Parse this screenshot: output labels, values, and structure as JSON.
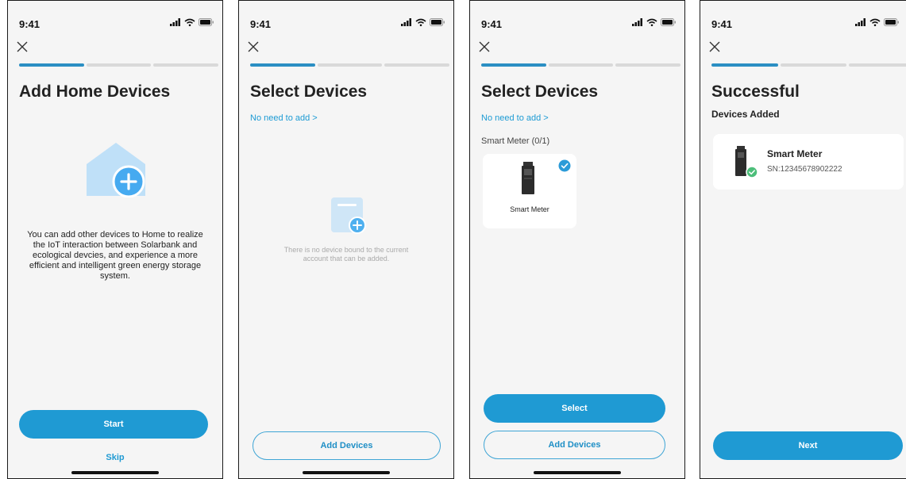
{
  "status": {
    "time": "9:41"
  },
  "screens": {
    "s1": {
      "title": "Add Home Devices",
      "description": "You can add other devices to Home to realize the IoT interaction between Solarbank and ecological devcies, and experience a more efficient and intelligent green energy storage system.",
      "start_label": "Start",
      "skip_label": "Skip"
    },
    "s2": {
      "title": "Select Devices",
      "no_need_link": "No need to add >",
      "empty_text": "There is no device bound to the current account that can be added.",
      "add_devices_label": "Add Devices"
    },
    "s3": {
      "title": "Select Devices",
      "no_need_link": "No need to add >",
      "section_label": "Smart Meter (0/1)",
      "device_name": "Smart Meter",
      "select_label": "Select",
      "add_devices_label": "Add Devices"
    },
    "s4": {
      "title": "Successful",
      "subtitle": "Devices Added",
      "device_name": "Smart Meter",
      "device_sn": "SN:12345678902222",
      "next_label": "Next"
    }
  },
  "colors": {
    "accent": "#1f9ad3",
    "progress_active": "#2b8fc3",
    "success": "#4cbe7a"
  },
  "icons": [
    "close-icon",
    "signal-icon",
    "wifi-icon",
    "battery-icon",
    "home-add-icon",
    "device-add-icon",
    "check-icon",
    "smart-meter-icon"
  ]
}
